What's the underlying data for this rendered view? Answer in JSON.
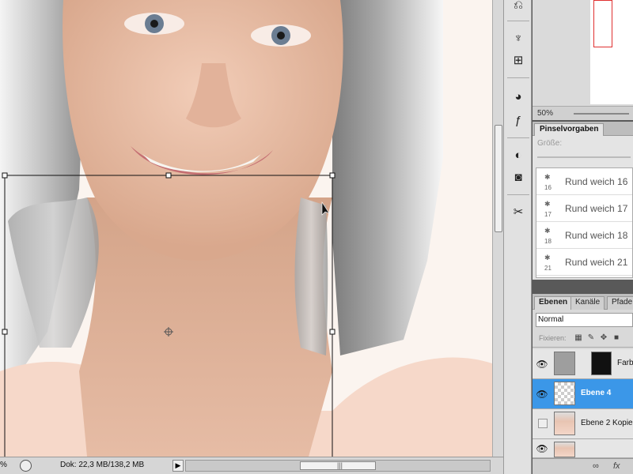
{
  "status_bar": {
    "zoom": "%",
    "doc_info": "Dok: 22,3 MB/138,2 MB",
    "arrow": "▶",
    "grip": "|||"
  },
  "navigator": {
    "zoom": "50%"
  },
  "brush_presets": {
    "tab_label": "Pinselvorgaben",
    "size_label": "Größe:",
    "brushes": [
      {
        "num": "16",
        "label": "Rund weich 16"
      },
      {
        "num": "17",
        "label": "Rund weich 17"
      },
      {
        "num": "18",
        "label": "Rund weich 18"
      },
      {
        "num": "21",
        "label": "Rund weich 21"
      }
    ]
  },
  "layers": {
    "tabs": [
      "Ebenen",
      "Kanäle",
      "Pfade"
    ],
    "blend_mode": "Normal",
    "lock_label": "Fixieren:",
    "items": [
      {
        "name": "Farb",
        "visible": true,
        "selected": false
      },
      {
        "name": "Ebene 4",
        "visible": true,
        "selected": true
      },
      {
        "name": "Ebene 2 Kopie",
        "visible": false,
        "selected": false
      },
      {
        "name": "",
        "visible": true,
        "selected": false
      }
    ],
    "bottom_icons": [
      "link-icon",
      "fx-icon"
    ],
    "fx_label": "fx"
  },
  "icon_strip": [
    "history-brush-icon",
    "clone-stamp-icon",
    "pattern-stamp-icon",
    "swatches-icon",
    "styles-icon",
    "adjustments-icon",
    "masks-icon",
    "tools-icon"
  ],
  "colors": {
    "selection": "#3b97e8",
    "panel_bg": "#d9d9d9"
  }
}
